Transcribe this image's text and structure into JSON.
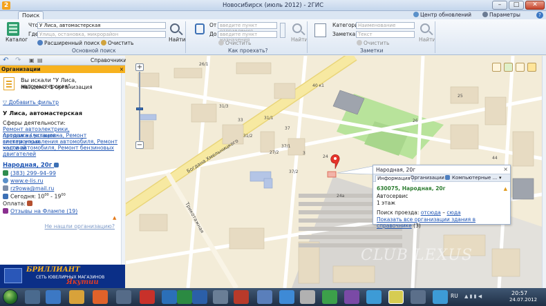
{
  "window": {
    "title": "Новосибирск (июль 2012) - 2ГИС",
    "app_icon": "2"
  },
  "ribbon": {
    "tab": "Поиск",
    "update_center": "Центр обновлений",
    "parameters": "Параметры",
    "catalog_label": "Каталог",
    "search": {
      "what_label": "Что",
      "what_value": "У Лиса, автомастерская",
      "where_label": "Где",
      "where_placeholder": "Улица, остановка, микрорайон",
      "find": "Найти",
      "extended": "Расширенный поиск",
      "clear": "Очистить",
      "group": "Основной поиск"
    },
    "route": {
      "from_label": "От",
      "from_placeholder": "введите пункт отправления",
      "to_label": "До",
      "to_placeholder": "введите пункт назначения",
      "find": "Найти",
      "clear": "Очистить",
      "group": "Как проехать?"
    },
    "notes": {
      "category_label": "Категория",
      "category_placeholder": "Наименование",
      "note_label": "Заметка",
      "note_placeholder": "Текст",
      "find": "Найти",
      "clear": "Очистить",
      "group": "Заметки"
    }
  },
  "left_panel": {
    "directories": "Справочники",
    "header": "Организации",
    "searched_for": "Вы искали \"У Лиса, автомастерская\"",
    "found": "Найдено: 1 организация",
    "add_filter": "Добавить фильтр",
    "org_name": "У Лиса, автомастерская",
    "activities_label": "Сферы деятельности:",
    "activities": [
      "Ремонт автоэлектрики, Автосигнализации -",
      "продажа / установка, Ремонт электронных",
      "систем управления автомобиля, Ремонт ходовой",
      "части автомобиля, Ремонт бензиновых",
      "двигателей"
    ],
    "address": "Народная, 20г",
    "phone": "(383) 299–94–99",
    "website": "www.e-lis.ru",
    "email": "rz9owa@mail.ru",
    "hours_prefix": "Сегодня: 10",
    "hours_open_sup": "00",
    "hours_sep": " - 19",
    "hours_close_sup": "00",
    "payment_label": "Оплата:",
    "reviews": "Отзывы на Флампе (19)",
    "not_found": "Не нашли организацию?"
  },
  "banner": {
    "title": "БРИЛЛИАНТ",
    "subtitle": "СЕТЬ ЮВЕЛИРНЫХ МАГАЗИНОВ",
    "brand": "Якутии"
  },
  "map": {
    "street_1": "Богдана Хмельницкого",
    "street_2": "Трикотажная",
    "labels": [
      "26/1",
      "40 к1",
      "31/3",
      "33",
      "27/2",
      "24",
      "3",
      "31/2",
      "37/1",
      "37/2",
      "25",
      "26",
      "24а",
      "44",
      "31/1",
      "37"
    ],
    "popup": {
      "title": "Народная, 20г",
      "tabs": [
        "Информация",
        "Организации",
        "Компьютерные ..."
      ],
      "address": "630075, Народная, 20г",
      "type": "Автосервис",
      "floors": "1 этаж",
      "entry_prefix": "Поиск проезда:",
      "entry_from": "отсюда",
      "entry_sep": "–",
      "entry_to": "сюда",
      "show_all": "Показать все организации здания в справочнике",
      "count": "(3)"
    }
  },
  "taskbar": {
    "lang": "RU",
    "time": "20:57",
    "date": "24.07.2012"
  },
  "colors": {
    "map_bg": "#f3ecd8",
    "road": "#f7e9a1",
    "park": "#b8e39b",
    "header_orange": "#f7b21f",
    "link_blue": "#1f55b4"
  }
}
